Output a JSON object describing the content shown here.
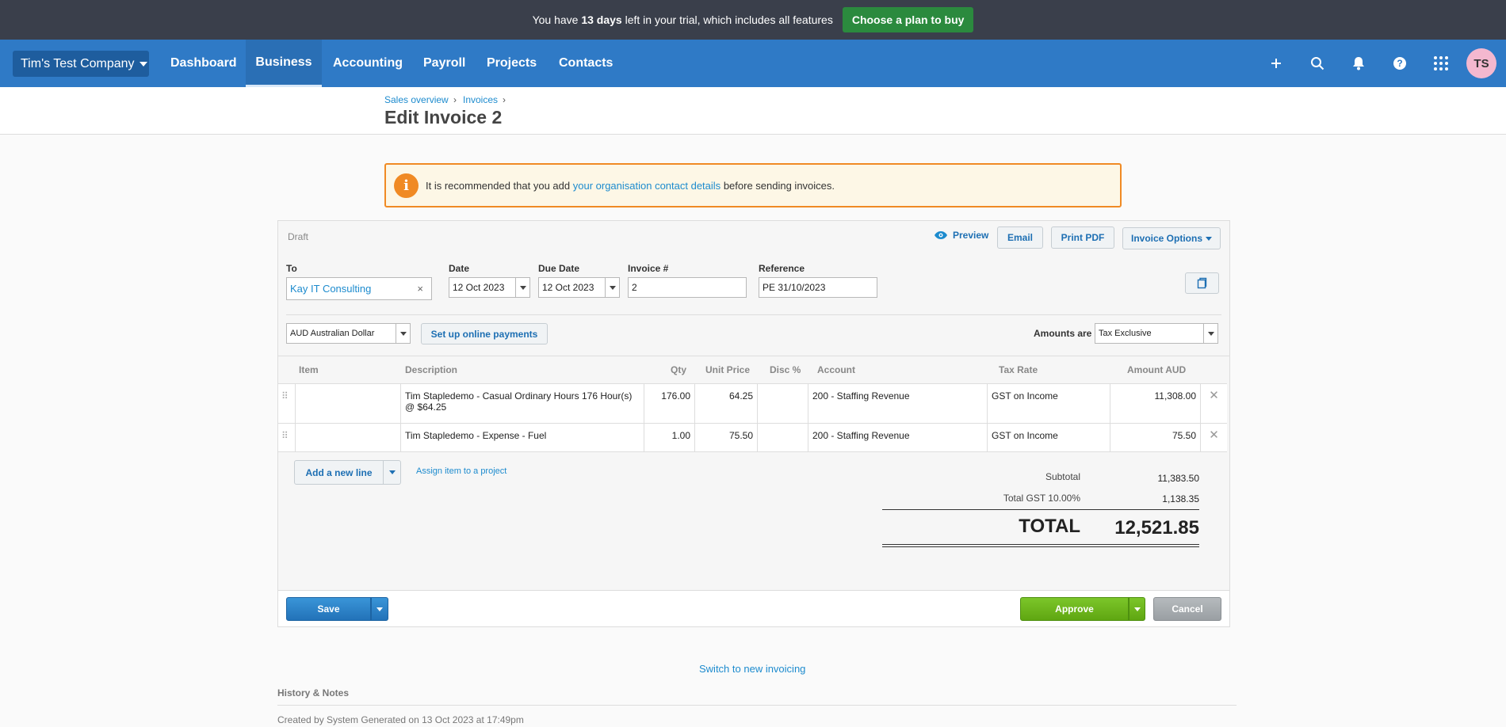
{
  "trial": {
    "prefix": "You have ",
    "days": "13 days",
    "suffix": " left in your trial, which includes all features",
    "cta": "Choose a plan to buy"
  },
  "org": {
    "name": "Tim's Test Company"
  },
  "nav": {
    "items": [
      "Dashboard",
      "Business",
      "Accounting",
      "Payroll",
      "Projects",
      "Contacts"
    ],
    "active": "Business",
    "avatar": "TS"
  },
  "breadcrumb": [
    "Sales overview",
    "Invoices"
  ],
  "page_title": "Edit Invoice 2",
  "alert": {
    "before": "It is recommended that you add ",
    "link": "your organisation contact details",
    "after": " before sending invoices."
  },
  "invoice": {
    "status": "Draft",
    "actions": {
      "preview": "Preview",
      "email": "Email",
      "print": "Print PDF",
      "options": "Invoice Options"
    },
    "labels": {
      "to": "To",
      "date": "Date",
      "due": "Due Date",
      "number": "Invoice #",
      "reference": "Reference"
    },
    "to": "Kay IT Consulting",
    "date": "12 Oct 2023",
    "due_date": "12 Oct 2023",
    "number": "2",
    "reference": "PE 31/10/2023",
    "currency": "AUD Australian Dollar",
    "online_payments": "Set up online payments",
    "amounts_are_label": "Amounts are",
    "amounts_are": "Tax Exclusive",
    "columns": [
      "Item",
      "Description",
      "Qty",
      "Unit Price",
      "Disc %",
      "Account",
      "Tax Rate",
      "Amount AUD"
    ],
    "lines": [
      {
        "item": "",
        "description": "Tim Stapledemo - Casual Ordinary Hours 176 Hour(s) @ $64.25",
        "qty": "176.00",
        "unit_price": "64.25",
        "disc": "",
        "account": "200 - Staffing Revenue",
        "tax_rate": "GST on Income",
        "amount": "11,308.00"
      },
      {
        "item": "",
        "description": "Tim Stapledemo - Expense - Fuel",
        "qty": "1.00",
        "unit_price": "75.50",
        "disc": "",
        "account": "200 - Staffing Revenue",
        "tax_rate": "GST on Income",
        "amount": "75.50"
      }
    ],
    "add_line": "Add a new line",
    "assign_project": "Assign item to a project",
    "totals": {
      "subtotal_label": "Subtotal",
      "subtotal": "11,383.50",
      "gst_label": "Total GST 10.00%",
      "gst": "1,138.35",
      "total_label": "TOTAL",
      "total": "12,521.85"
    },
    "save": "Save",
    "approve": "Approve",
    "cancel": "Cancel"
  },
  "switch_link": "Switch to new invoicing",
  "history": {
    "title": "History & Notes",
    "entry": "Created by System Generated on 13 Oct 2023 at 17:49pm"
  },
  "colors": {
    "trial_bg": "#3a3f4b",
    "nav": "#2f7ac6",
    "link": "#1d8bce",
    "warning": "#f08a24",
    "approve": "#6cb41b",
    "avatar": "#f4b8cf"
  }
}
